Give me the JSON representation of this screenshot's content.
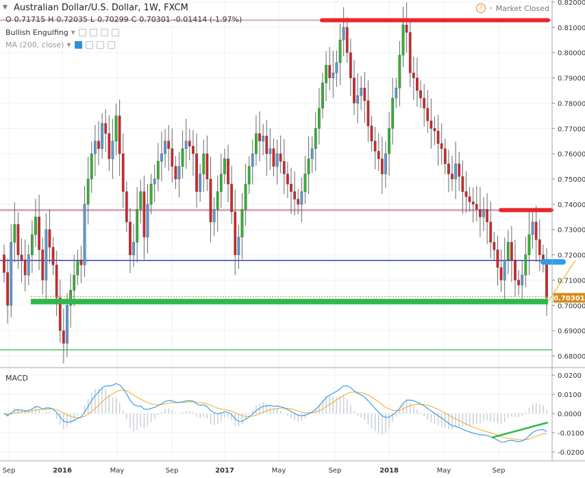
{
  "header": {
    "symbol_title": "Australian Dollar/U.S. Dollar, 1W, FXCM",
    "ohlc": [
      {
        "label": "O",
        "value": "0.71715"
      },
      {
        "label": "H",
        "value": "0.72035"
      },
      {
        "label": "L",
        "value": "0.70299"
      },
      {
        "label": "C",
        "value": "0.70301"
      }
    ],
    "change": "-0.01414 (-1.97%)",
    "status": "Market Closed"
  },
  "indicators": [
    {
      "name": "Bullish Engulfing"
    },
    {
      "name": "MA (200, close)"
    }
  ],
  "macd_label": "MACD",
  "colors": {
    "up": "#5b9bd5",
    "down": "#d6242b",
    "engulf": "#2fb52f",
    "resistance_red": "#e8262b",
    "pink_line": "#d8a8b8",
    "navy_line": "#1f2fbf",
    "green_support": "#2fb84a",
    "price_tag": "#d88a1a",
    "macd_line": "#3a9ee4",
    "signal": "#f5a623",
    "cyan_marker": "#2a9ee3"
  },
  "price_axis": {
    "ticks": [
      "0.82000",
      "0.81000",
      "0.80000",
      "0.79000",
      "0.78000",
      "0.77000",
      "0.76000",
      "0.75000",
      "0.74000",
      "0.73000",
      "0.72000",
      "0.71000",
      "0.70000",
      "0.69000",
      "0.68000"
    ],
    "last_price": "0.70301"
  },
  "macd_axis": {
    "ticks": [
      "0.0200",
      "0.0100",
      "0.0000",
      "-0.0100",
      "-0.0200"
    ]
  },
  "time_axis": {
    "labels": [
      "Sep",
      "2016",
      "May",
      "Sep",
      "2017",
      "May",
      "Sep",
      "2018",
      "May",
      "Sep"
    ]
  },
  "chart_data": {
    "type": "candlestick",
    "title": "Australian Dollar/U.S. Dollar, 1W, FXCM",
    "ylim": [
      0.676,
      0.822
    ],
    "closes": [
      0.713,
      0.7,
      0.725,
      0.732,
      0.72,
      0.718,
      0.712,
      0.72,
      0.728,
      0.735,
      0.722,
      0.71,
      0.73,
      0.723,
      0.716,
      0.703,
      0.69,
      0.685,
      0.7,
      0.706,
      0.712,
      0.718,
      0.716,
      0.74,
      0.75,
      0.76,
      0.765,
      0.762,
      0.772,
      0.768,
      0.758,
      0.765,
      0.775,
      0.76,
      0.745,
      0.733,
      0.72,
      0.725,
      0.738,
      0.745,
      0.727,
      0.74,
      0.748,
      0.75,
      0.757,
      0.76,
      0.765,
      0.762,
      0.755,
      0.75,
      0.755,
      0.762,
      0.765,
      0.763,
      0.76,
      0.745,
      0.752,
      0.76,
      0.75,
      0.733,
      0.738,
      0.745,
      0.752,
      0.758,
      0.748,
      0.737,
      0.72,
      0.727,
      0.738,
      0.748,
      0.755,
      0.76,
      0.768,
      0.765,
      0.767,
      0.76,
      0.762,
      0.755,
      0.76,
      0.757,
      0.752,
      0.748,
      0.745,
      0.742,
      0.74,
      0.745,
      0.752,
      0.758,
      0.762,
      0.77,
      0.778,
      0.788,
      0.795,
      0.79,
      0.792,
      0.796,
      0.805,
      0.81,
      0.8,
      0.79,
      0.78,
      0.783,
      0.786,
      0.781,
      0.771,
      0.765,
      0.761,
      0.758,
      0.752,
      0.76,
      0.77,
      0.782,
      0.786,
      0.799,
      0.811,
      0.808,
      0.792,
      0.79,
      0.785,
      0.782,
      0.778,
      0.773,
      0.77,
      0.769,
      0.764,
      0.762,
      0.756,
      0.752,
      0.75,
      0.756,
      0.751,
      0.745,
      0.743,
      0.741,
      0.74,
      0.738,
      0.735,
      0.738,
      0.733,
      0.725,
      0.722,
      0.715,
      0.71,
      0.718,
      0.725,
      0.718,
      0.71,
      0.708,
      0.712,
      0.72,
      0.728,
      0.733,
      0.726,
      0.72,
      0.717,
      0.703
    ]
  }
}
